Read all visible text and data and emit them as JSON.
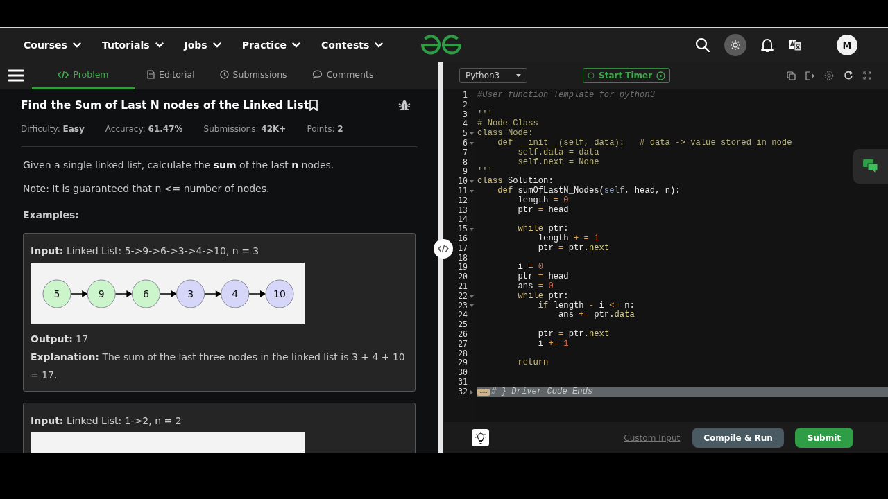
{
  "nav": {
    "menus": [
      {
        "label": "Courses"
      },
      {
        "label": "Tutorials"
      },
      {
        "label": "Jobs"
      },
      {
        "label": "Practice"
      },
      {
        "label": "Contests"
      }
    ],
    "avatar": "M"
  },
  "problem_tabs": [
    {
      "label": "Problem",
      "selected": true
    },
    {
      "label": "Editorial",
      "selected": false
    },
    {
      "label": "Submissions",
      "selected": false
    },
    {
      "label": "Comments",
      "selected": false
    }
  ],
  "problem": {
    "title": "Find the Sum of Last N nodes of the Linked List",
    "meta": [
      "Difficulty: **Easy**",
      "Accuracy: **61.47%**",
      "Submissions: **42K+**",
      "Points: **2**"
    ],
    "description": [
      "Given a single linked list, calculate the **sum** of the last **n** nodes.",
      "Note: It is guaranteed that n <= number of nodes."
    ],
    "examples_heading": "Examples:",
    "examples": [
      {
        "input": "**Input:** Linked List: 5->9->6->3->4->10, n = 3",
        "nodes": [
          {
            "value": "5",
            "color": "#ccf5cc"
          },
          {
            "value": "9",
            "color": "#ccf5cc"
          },
          {
            "value": "6",
            "color": "#ccf5cc"
          },
          {
            "value": "3",
            "color": "#d6d6f8"
          },
          {
            "value": "4",
            "color": "#d6d6f8"
          },
          {
            "value": "10",
            "color": "#d6d6f8"
          }
        ],
        "output": "**Output:** 17",
        "explanation": "**Explanation:** The sum of the last three nodes in the linked list is 3 + 4 + 10 = 17."
      },
      {
        "input": "**Input:** Linked List: 1->2, n = 2"
      }
    ]
  },
  "editor": {
    "language": "Python3",
    "timer_button": "Start Timer",
    "lines": [
      {
        "number": "1",
        "kind": "code",
        "foldable": false,
        "tokens": [
          {
            "text": "#User function Template for python3",
            "kind": "comment"
          }
        ]
      },
      {
        "number": "2",
        "kind": "code",
        "foldable": false
      },
      {
        "number": "3",
        "kind": "code",
        "foldable": false,
        "tokens": [
          {
            "text": "'''",
            "kind": "str"
          }
        ]
      },
      {
        "number": "4",
        "kind": "code",
        "foldable": false,
        "tokens": [
          {
            "text": "# Node Class",
            "kind": "str"
          }
        ]
      },
      {
        "number": "5",
        "kind": "code",
        "foldable": true,
        "tokens": [
          {
            "text": "class Node:",
            "kind": "str"
          }
        ]
      },
      {
        "number": "6",
        "kind": "code",
        "foldable": true,
        "tokens": [
          {
            "text": "    def __init__(self, data):   # data -> value stored in node",
            "kind": "str"
          }
        ]
      },
      {
        "number": "7",
        "kind": "code",
        "foldable": false,
        "tokens": [
          {
            "text": "        self.data = data",
            "kind": "str"
          }
        ]
      },
      {
        "number": "8",
        "kind": "code",
        "foldable": false,
        "tokens": [
          {
            "text": "        self.next = None",
            "kind": "str"
          }
        ]
      },
      {
        "number": "9",
        "kind": "code",
        "foldable": false,
        "tokens": [
          {
            "text": "'''",
            "kind": "str"
          }
        ]
      },
      {
        "number": "10",
        "kind": "code",
        "foldable": true,
        "tokens": [
          {
            "text": "class",
            "kind": "kw"
          },
          {
            "text": " Solution:",
            "kind": "plain"
          }
        ]
      },
      {
        "number": "11",
        "kind": "code",
        "foldable": true,
        "tokens": [
          {
            "text": "    def",
            "kind": "kw"
          },
          {
            "text": " sumOfLastN_Nodes(",
            "kind": "plain"
          },
          {
            "text": "self",
            "kind": "self"
          },
          {
            "text": ", head, n):",
            "kind": "plain"
          }
        ]
      },
      {
        "number": "12",
        "kind": "code",
        "foldable": false,
        "tokens": [
          {
            "text": "        length ",
            "kind": "plain"
          },
          {
            "text": "=",
            "kind": "op"
          },
          {
            "text": " 0",
            "kind": "num"
          }
        ]
      },
      {
        "number": "13",
        "kind": "code",
        "foldable": false,
        "tokens": [
          {
            "text": "        ptr ",
            "kind": "plain"
          },
          {
            "text": "=",
            "kind": "op"
          },
          {
            "text": " head",
            "kind": "plain"
          }
        ]
      },
      {
        "number": "14",
        "kind": "code",
        "foldable": false
      },
      {
        "number": "15",
        "kind": "code",
        "foldable": true,
        "tokens": [
          {
            "text": "        while",
            "kind": "kw"
          },
          {
            "text": " ptr:",
            "kind": "plain"
          }
        ]
      },
      {
        "number": "16",
        "kind": "code",
        "foldable": false,
        "tokens": [
          {
            "text": "            length ",
            "kind": "plain"
          },
          {
            "text": "+-=",
            "kind": "op"
          },
          {
            "text": " 1",
            "kind": "num"
          }
        ]
      },
      {
        "number": "17",
        "kind": "code",
        "foldable": false,
        "tokens": [
          {
            "text": "            ptr ",
            "kind": "plain"
          },
          {
            "text": "=",
            "kind": "op"
          },
          {
            "text": " ptr.",
            "kind": "plain"
          },
          {
            "text": "next",
            "kind": "attr"
          }
        ]
      },
      {
        "number": "18",
        "kind": "code",
        "foldable": false
      },
      {
        "number": "19",
        "kind": "code",
        "foldable": false,
        "tokens": [
          {
            "text": "        i ",
            "kind": "plain"
          },
          {
            "text": "=",
            "kind": "op"
          },
          {
            "text": " 0",
            "kind": "num"
          }
        ]
      },
      {
        "number": "20",
        "kind": "code",
        "foldable": false,
        "tokens": [
          {
            "text": "        ptr ",
            "kind": "plain"
          },
          {
            "text": "=",
            "kind": "op"
          },
          {
            "text": " head",
            "kind": "plain"
          }
        ]
      },
      {
        "number": "21",
        "kind": "code",
        "foldable": false,
        "tokens": [
          {
            "text": "        ans ",
            "kind": "plain"
          },
          {
            "text": "=",
            "kind": "op"
          },
          {
            "text": " 0",
            "kind": "num"
          }
        ]
      },
      {
        "number": "22",
        "kind": "code",
        "foldable": true,
        "tokens": [
          {
            "text": "        while",
            "kind": "kw"
          },
          {
            "text": " ptr:",
            "kind": "plain"
          }
        ]
      },
      {
        "number": "23",
        "kind": "code",
        "foldable": true,
        "tokens": [
          {
            "text": "            if",
            "kind": "kw"
          },
          {
            "text": " length ",
            "kind": "plain"
          },
          {
            "text": "-",
            "kind": "op"
          },
          {
            "text": " i ",
            "kind": "plain"
          },
          {
            "text": "<=",
            "kind": "op"
          },
          {
            "text": " n:",
            "kind": "plain"
          }
        ]
      },
      {
        "number": "24",
        "kind": "code",
        "foldable": false,
        "tokens": [
          {
            "text": "                ans ",
            "kind": "plain"
          },
          {
            "text": "+=",
            "kind": "op"
          },
          {
            "text": " ptr.",
            "kind": "plain"
          },
          {
            "text": "data",
            "kind": "attr"
          }
        ]
      },
      {
        "number": "25",
        "kind": "code",
        "foldable": false
      },
      {
        "number": "26",
        "kind": "code",
        "foldable": false,
        "tokens": [
          {
            "text": "            ptr ",
            "kind": "plain"
          },
          {
            "text": "=",
            "kind": "op"
          },
          {
            "text": " ptr.",
            "kind": "plain"
          },
          {
            "text": "next",
            "kind": "attr"
          }
        ]
      },
      {
        "number": "27",
        "kind": "code",
        "foldable": false,
        "tokens": [
          {
            "text": "            i ",
            "kind": "plain"
          },
          {
            "text": "+=",
            "kind": "op"
          },
          {
            "text": " 1",
            "kind": "num"
          }
        ]
      },
      {
        "number": "28",
        "kind": "code",
        "foldable": false
      },
      {
        "number": "29",
        "kind": "code",
        "foldable": false,
        "tokens": [
          {
            "text": "        return",
            "kind": "kw"
          }
        ]
      },
      {
        "number": "30",
        "kind": "code",
        "foldable": false
      },
      {
        "number": "31",
        "kind": "code",
        "foldable": false
      },
      {
        "number": "32",
        "kind": "folded",
        "foldable": true,
        "tokens": [
          {
            "text": "# } Driver Code Ends",
            "kind": "comment"
          }
        ]
      }
    ],
    "custom_input": "Custom Input",
    "compile_button": "Compile & Run",
    "submit_button": "Submit"
  }
}
